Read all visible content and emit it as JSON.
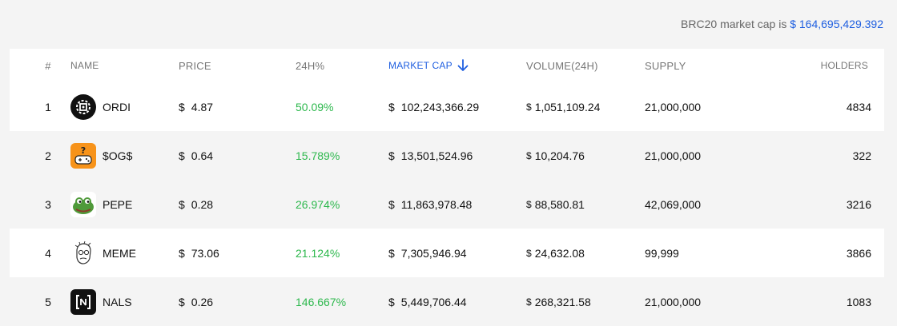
{
  "market_cap": {
    "label": "BRC20 market cap is",
    "value": "$ 164,695,429.392",
    "accent": "#1f5fe0"
  },
  "columns": {
    "rank": "#",
    "name": "NAME",
    "price": "PRICE",
    "change": "24H%",
    "market_cap": "MARKET CAP",
    "volume": "VOLUME(24H)",
    "supply": "SUPPLY",
    "holders": "HOLDERS"
  },
  "sort_icon": "arrow-down-icon",
  "currency_symbol": "$",
  "change_color": "#2db84d",
  "rows": [
    {
      "rank": "1",
      "name": "ORDI",
      "icon": "ordi-logo-icon",
      "price": "4.87",
      "change": "50.09%",
      "market_cap": "102,243,366.29",
      "volume": "1,051,109.24",
      "supply": "21,000,000",
      "holders": "4834"
    },
    {
      "rank": "2",
      "name": "$OG$",
      "icon": "og-gamepad-logo-icon",
      "price": "0.64",
      "change": "15.789%",
      "market_cap": "13,501,524.96",
      "volume": "10,204.76",
      "supply": "21,000,000",
      "holders": "322"
    },
    {
      "rank": "3",
      "name": "PEPE",
      "icon": "pepe-frog-logo-icon",
      "price": "0.28",
      "change": "26.974%",
      "market_cap": "11,863,978.48",
      "volume": "88,580.81",
      "supply": "42,069,000",
      "holders": "3216"
    },
    {
      "rank": "4",
      "name": "MEME",
      "icon": "meme-face-logo-icon",
      "price": "73.06",
      "change": "21.124%",
      "market_cap": "7,305,946.94",
      "volume": "24,632.08",
      "supply": "99,999",
      "holders": "3866"
    },
    {
      "rank": "5",
      "name": "NALS",
      "icon": "nals-logo-icon",
      "price": "0.26",
      "change": "146.667%",
      "market_cap": "5,449,706.44",
      "volume": "268,321.58",
      "supply": "21,000,000",
      "holders": "1083"
    }
  ]
}
